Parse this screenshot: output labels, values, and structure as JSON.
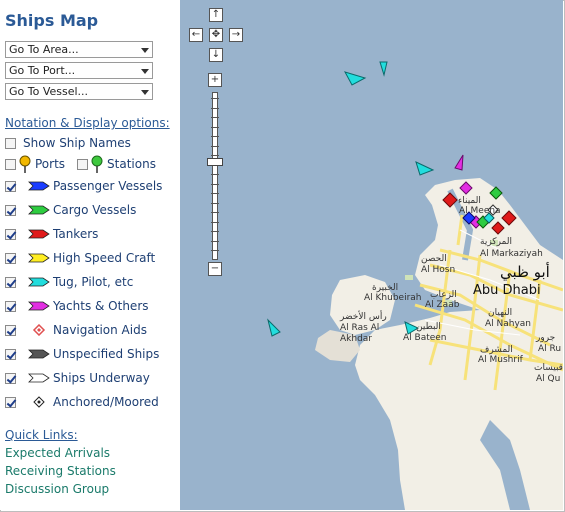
{
  "sidebar": {
    "title": "Ships Map",
    "selects": [
      {
        "value": "Go To Area..."
      },
      {
        "value": "Go To Port..."
      },
      {
        "value": "Go To Vessel..."
      }
    ],
    "notation_heading": "Notation & Display options:",
    "show_ship_names": {
      "label": "Show Ship Names",
      "checked": false
    },
    "ports": {
      "label": "Ports",
      "checked": false
    },
    "stations": {
      "label": "Stations",
      "checked": false
    },
    "vessel_types": [
      {
        "label": "Passenger Vessels",
        "color": "#1a3cff",
        "icon": "passenger-vessel-icon",
        "checked": true
      },
      {
        "label": "Cargo Vessels",
        "color": "#2ecc40",
        "icon": "cargo-vessel-icon",
        "checked": true
      },
      {
        "label": "Tankers",
        "color": "#e01a1a",
        "icon": "tanker-icon",
        "checked": true
      },
      {
        "label": "High Speed Craft",
        "color": "#ffee22",
        "icon": "high-speed-craft-icon",
        "checked": true
      },
      {
        "label": "Tug, Pilot, etc",
        "color": "#22dddd",
        "icon": "tug-pilot-icon",
        "checked": true
      },
      {
        "label": "Yachts & Others",
        "color": "#e22ee2",
        "icon": "yacht-icon",
        "checked": true
      },
      {
        "label": "Navigation Aids",
        "color": "#e05050",
        "icon": "navigation-aid-icon",
        "checked": true
      },
      {
        "label": "Unspecified Ships",
        "color": "#555555",
        "icon": "unspecified-ship-icon",
        "checked": true
      },
      {
        "label": "Ships Underway",
        "color": "#ffffff",
        "icon": "ship-underway-icon",
        "checked": true
      },
      {
        "label": "Anchored/Moored",
        "color": "#ffffff",
        "icon": "anchored-icon",
        "checked": true
      }
    ],
    "quick_links_heading": "Quick Links:",
    "quick_links": [
      "Expected Arrivals",
      "Receiving Stations",
      "Discussion Group"
    ]
  },
  "map": {
    "nav": {
      "up": "↑",
      "down": "↓",
      "left": "←",
      "right": "→",
      "center": "✥",
      "zoom_in": "+",
      "zoom_out": "−"
    },
    "labels": {
      "al_mina_ar": "الميناء",
      "al_meena": "Al Meena",
      "al_markaziya_ar": "المركزية",
      "al_markaziyah": "Al Markaziyah",
      "abu_dhabi_ar": "أبو ظبي",
      "abu_dhabi": "Abu Dhabi",
      "al_hosn_ar": "الحصن",
      "al_hosn": "Al Hosn",
      "al_khubeirah_ar": "الخبيرة",
      "al_khubeirah": "Al Khubeirah",
      "al_zaab_ar": "الزعاب",
      "al_zaab": "Al Zaab",
      "ras_al_akhdar_ar": "رأس الأخضر",
      "al_ras_al_akhdar": "Al Ras Al Akhdar",
      "al_bateen_ar": "البطين",
      "al_bateen": "Al Bateen",
      "al_nahyan_ar": "النهيان",
      "al_nahyan": "Al Nahyan",
      "al_mushrif_ar": "المشرف",
      "al_mushrif": "Al Mushrif",
      "al_qubaisat": "Al Qu",
      "qubaisat_ar": "قبيسات",
      "al_ru": "Al Ru",
      "ajrur_ar": "جرور",
      "al_mina_zone": "Al Meena"
    }
  }
}
